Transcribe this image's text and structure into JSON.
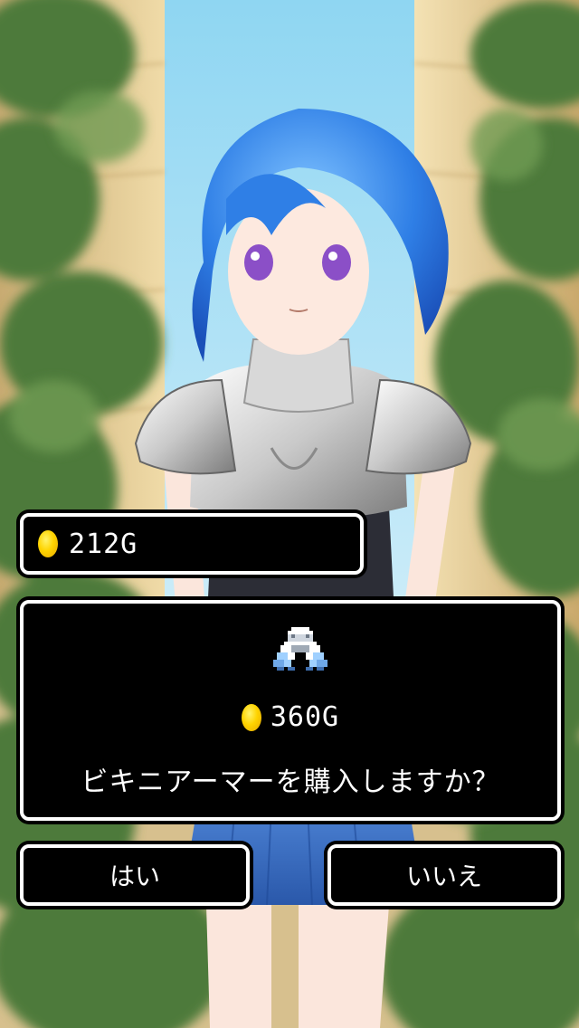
{
  "gold": {
    "amount_label": "212G",
    "icon": "coin-icon"
  },
  "dialog": {
    "item_icon": "armor-icon",
    "price_label": "360G",
    "question": "ビキニアーマーを購入しますか？"
  },
  "buttons": {
    "yes_label": "はい",
    "no_label": "いいえ"
  },
  "colors": {
    "window_bg": "#000000",
    "window_border": "#ffffff",
    "coin": "#ffd400",
    "hair": "#3a78d8",
    "skirt": "#3d6fc4",
    "sky": "#bfe8f6",
    "foliage": "#4c7a3a",
    "wall": "#d9c08a"
  }
}
